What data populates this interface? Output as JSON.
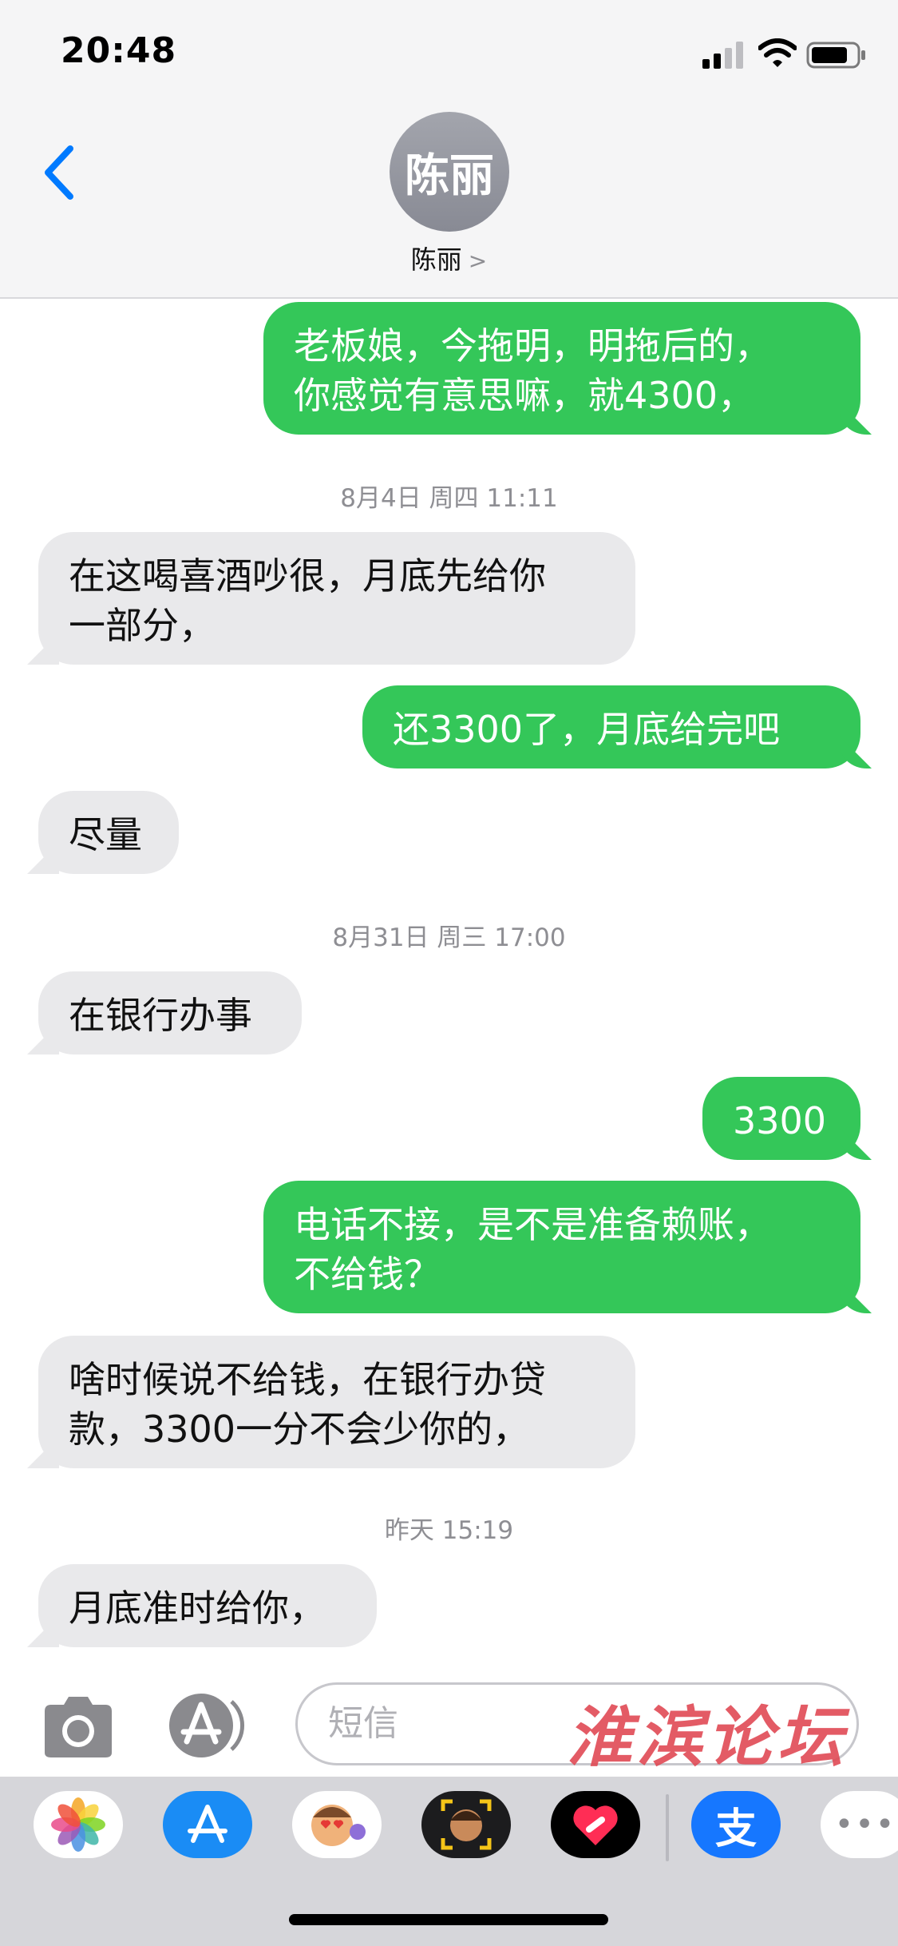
{
  "status_bar": {
    "time": "20:48"
  },
  "header": {
    "avatar_text": "陈丽",
    "contact_name": "陈丽",
    "chevron": ">"
  },
  "messages": [
    {
      "type": "out",
      "text": "老板娘，今拖明，明拖后的，\n你感觉有意思嘛，就4300，"
    },
    {
      "type": "timestamp",
      "text": "8月4日 周四 11:11"
    },
    {
      "type": "in",
      "text": "在这喝喜酒吵很，月底先给你\n一部分，"
    },
    {
      "type": "out",
      "text": "还3300了，月底给完吧"
    },
    {
      "type": "in",
      "text": "尽量"
    },
    {
      "type": "timestamp",
      "text": "8月31日 周三 17:00"
    },
    {
      "type": "in",
      "text": "在银行办事"
    },
    {
      "type": "out",
      "text": "3300"
    },
    {
      "type": "out",
      "text": "电话不接，是不是准备赖账，\n不给钱？"
    },
    {
      "type": "in",
      "text": "啥时候说不给钱，在银行办贷\n款，3300一分不会少你的，"
    },
    {
      "type": "timestamp",
      "text": "昨天 15:19"
    },
    {
      "type": "in",
      "text": "月底准时给你，"
    }
  ],
  "composer": {
    "placeholder": "短信",
    "watermark": "淮滨论坛"
  },
  "app_drawer": {
    "icons": [
      "photos-icon",
      "app-store-icon",
      "memoji-stickers-icon",
      "animoji-icon",
      "digital-touch-icon",
      "alipay-icon",
      "more-icon"
    ],
    "alipay_glyph": "支",
    "more_glyph": "•••"
  },
  "colors": {
    "outgoing": "#34c759",
    "incoming": "#e9e9eb",
    "ios_blue": "#007aff"
  }
}
